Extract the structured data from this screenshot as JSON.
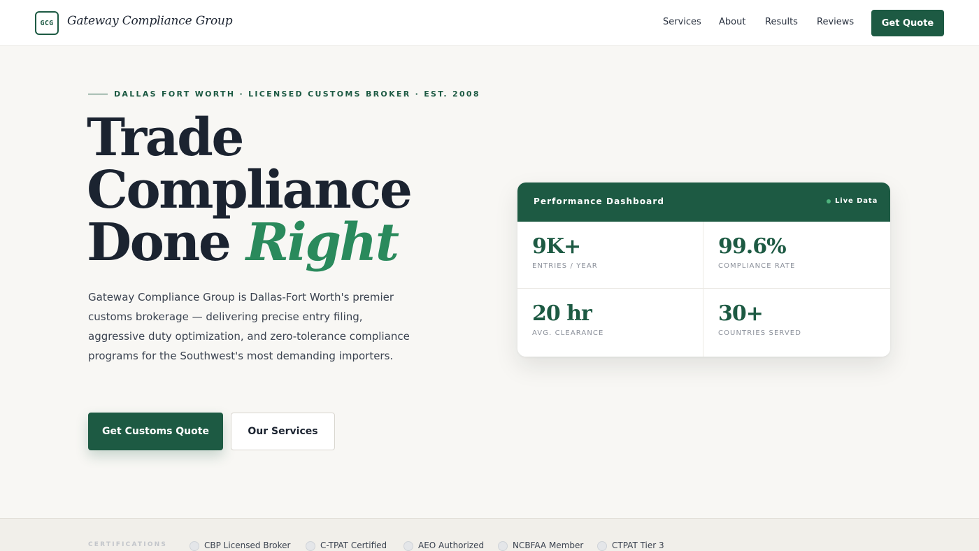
{
  "header": {
    "logo_mark": "GCG",
    "brand_name": "Gateway Compliance Group",
    "nav": [
      "Services",
      "About",
      "Results",
      "Reviews"
    ],
    "cta": "Get Quote"
  },
  "hero": {
    "eyebrow": "DALLAS FORT WORTH · LICENSED CUSTOMS BROKER · EST. 2008",
    "headline_line1": "Trade",
    "headline_line2": "Compliance",
    "headline_line3_plain": "Done",
    "headline_line3_accent": "Right",
    "intro": "Gateway Compliance Group is Dallas-Fort Worth's premier customs brokerage — delivering precise entry filing, aggressive duty optimization, and zero-tolerance compliance programs for the Southwest's most demanding importers.",
    "primary_button": "Get Customs Quote",
    "secondary_button": "Our Services"
  },
  "dashboard": {
    "title": "Performance Dashboard",
    "live_label": "Live Data",
    "metrics": [
      {
        "value": "9K+",
        "label": "ENTRIES / YEAR"
      },
      {
        "value": "99.6%",
        "label": "COMPLIANCE RATE"
      },
      {
        "value": "20 hr",
        "label": "AVG. CLEARANCE"
      },
      {
        "value": "30+",
        "label": "COUNTRIES SERVED"
      }
    ]
  },
  "certifications": {
    "heading": "CERTIFICATIONS",
    "items": [
      {
        "label": "CBP Licensed Broker",
        "icon": "badge-icon"
      },
      {
        "label": "C-TPAT Certified",
        "icon": "badge-icon"
      },
      {
        "label": "AEO Authorized",
        "icon": "badge-icon"
      },
      {
        "label": "NCBFAA Member",
        "icon": "badge-icon"
      },
      {
        "label": "CTPAT Tier 3",
        "icon": "badge-icon"
      }
    ]
  },
  "colors": {
    "brand_green": "#1d5a43",
    "accent_green": "#2a8a5c",
    "live_dot": "#4fb47e",
    "page_background": "#f8f7f4"
  }
}
